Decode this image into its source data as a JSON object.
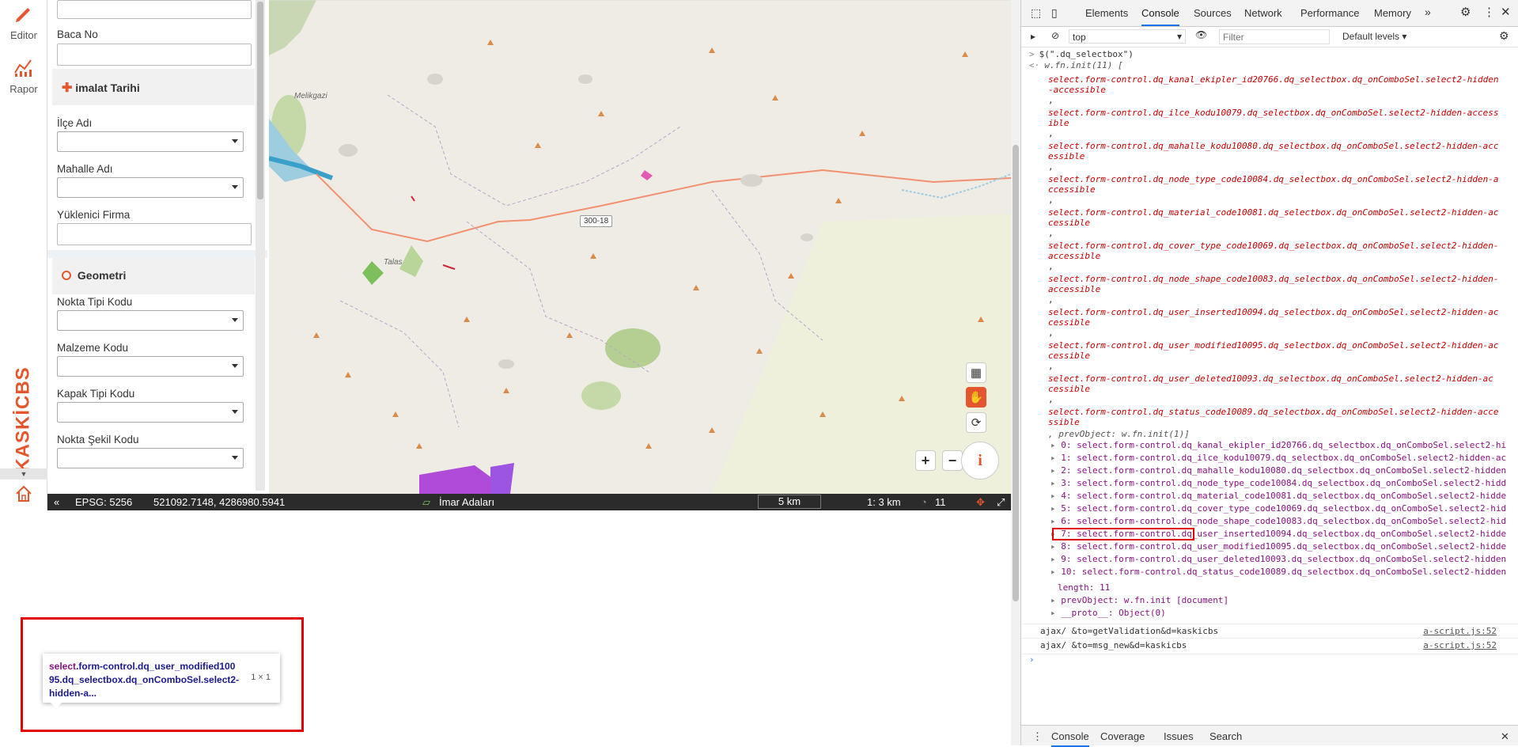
{
  "left_rail": {
    "editor_label": "Editor",
    "rapor_label": "Rapor",
    "brand_text": "KASKİCBS"
  },
  "form": {
    "fields_top": [
      {
        "label": "Baca No"
      }
    ],
    "section_imalat": "imalat Tarihi",
    "ilce_label": "İlçe Adı",
    "mahalle_label": "Mahalle Adı",
    "yuklenici_label": "Yüklenici Firma",
    "section_geometri": "Geometri",
    "nokta_tipi_label": "Nokta Tipi Kodu",
    "malzeme_label": "Malzeme Kodu",
    "kapak_label": "Kapak Tipi Kodu",
    "nokta_sekil_label": "Nokta Şekil Kodu"
  },
  "map": {
    "place_1": "Melikgazi",
    "place_2": "Talas",
    "road_label": "300-18",
    "zoom_in": "+",
    "zoom_out": "−",
    "info": "i"
  },
  "status_bar": {
    "epsg": "EPSG: 5256",
    "coords": "521092.7148,  4286980.5941",
    "layer": "İmar Adaları",
    "scale_bar": "5 km",
    "scale_ratio": "1: 3 km",
    "zoom_level": "11"
  },
  "devtools": {
    "tabs": [
      "Elements",
      "Console",
      "Sources",
      "Network",
      "Performance",
      "Memory"
    ],
    "context": "top",
    "filter_placeholder": "Filter",
    "levels": "Default levels",
    "command": "$(\".dq_selectbox\")",
    "init_summary": "w.fn.init(11) [",
    "selectors": [
      "select.form-control.dq_kanal_ekipler_id20766.dq_selectbox.dq_onComboSel.select2-hidden",
      "-accessible",
      "select.form-control.dq_ilce_kodu10079.dq_selectbox.dq_onComboSel.select2-hidden-access",
      "ible",
      "select.form-control.dq_mahalle_kodu10080.dq_selectbox.dq_onComboSel.select2-hidden-acc",
      "essible",
      "select.form-control.dq_node_type_code10084.dq_selectbox.dq_onComboSel.select2-hidden-a",
      "ccessible",
      "select.form-control.dq_material_code10081.dq_selectbox.dq_onComboSel.select2-hidden-ac",
      "cessible",
      "select.form-control.dq_cover_type_code10069.dq_selectbox.dq_onComboSel.select2-hidden-",
      "accessible",
      "select.form-control.dq_node_shape_code10083.dq_selectbox.dq_onComboSel.select2-hidden-",
      "accessible",
      "select.form-control.dq_user_inserted10094.dq_selectbox.dq_onComboSel.select2-hidden-ac",
      "cessible",
      "select.form-control.dq_user_modified10095.dq_selectbox.dq_onComboSel.select2-hidden-ac",
      "cessible",
      "select.form-control.dq_user_deleted10093.dq_selectbox.dq_onComboSel.select2-hidden-ac",
      "cessible",
      "select.form-control.dq_status_code10089.dq_selectbox.dq_onComboSel.select2-hidden-acce",
      "ssible"
    ],
    "prev_object_line": ", prevObject: w.fn.init(1)]",
    "items": [
      "0: select.form-control.dq_kanal_ekipler_id20766.dq_selectbox.dq_onComboSel.select2-hi",
      "1: select.form-control.dq_ilce_kodu10079.dq_selectbox.dq_onComboSel.select2-hidden-ac",
      "2: select.form-control.dq_mahalle_kodu10080.dq_selectbox.dq_onComboSel.select2-hidden",
      "3: select.form-control.dq_node_type_code10084.dq_selectbox.dq_onComboSel.select2-hidd",
      "4: select.form-control.dq_material_code10081.dq_selectbox.dq_onComboSel.select2-hidde",
      "5: select.form-control.dq_cover_type_code10069.dq_selectbox.dq_onComboSel.select2-hid",
      "6: select.form-control.dq_node_shape_code10083.dq_selectbox.dq_onComboSel.select2-hid",
      "7: select.form-control.dq_user_inserted10094.dq_selectbox.dq_onComboSel.select2-hidde",
      "8: select.form-control.dq_user_modified10095.dq_selectbox.dq_onComboSel.select2-hidde",
      "9: select.form-control.dq_user_deleted10093.dq_selectbox.dq_onComboSel.select2-hidden",
      "10: select.form-control.dq_status_code10089.dq_selectbox.dq_onComboSel.select2-hidden"
    ],
    "length_line": "length: 11",
    "prev_object_detail": "prevObject: w.fn.init [document]",
    "proto_line": "__proto__: Object(0)",
    "ajax_1": "ajax/ &to=getValidation&d=kaskicbs",
    "ajax_2": "ajax/ &to=msg_new&d=kaskicbs",
    "source_link": "a-script.js:52",
    "drawer_tabs": [
      "Console",
      "Coverage",
      "Issues",
      "Search"
    ]
  },
  "tooltip": {
    "tag": "select",
    "text": ".form-control.dq_user_modified10095.dq_selectbox.dq_onComboSel.select2-hidden-a...",
    "size": "1 × 1"
  }
}
